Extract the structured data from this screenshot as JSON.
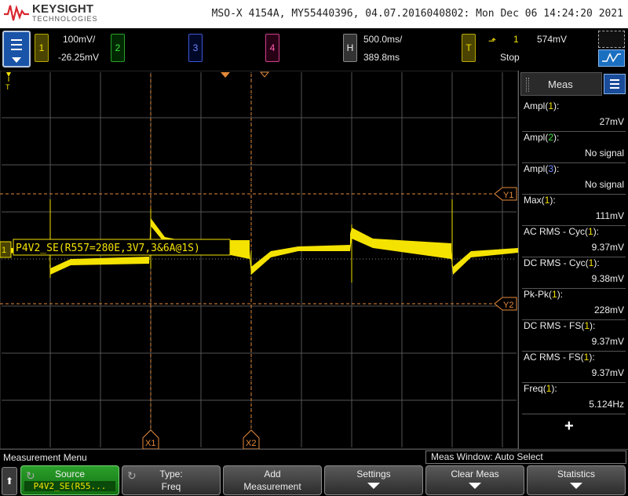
{
  "header": {
    "brand": "KEYSIGHT",
    "brand_sub": "TECHNOLOGIES",
    "instrument": "MSO-X 4154A, MY55440396, 04.07.2016040802: Mon Dec 06 14:24:20 2021"
  },
  "channels": {
    "ch1": {
      "num": "1",
      "scale": "100mV/",
      "offset": "-26.25mV",
      "color": "#f4e200"
    },
    "ch2": {
      "num": "2",
      "color": "#3ee63e"
    },
    "ch3": {
      "num": "3",
      "color": "#6b86ff"
    },
    "ch4": {
      "num": "4",
      "color": "#ff5fb0"
    },
    "horizontal": {
      "label": "H",
      "scale": "500.0ms/",
      "delay": "389.8ms"
    },
    "trigger": {
      "label": "T",
      "source": "1",
      "level": "574mV",
      "mode": "Stop"
    }
  },
  "graticule": {
    "waveform_label": "P4V2_SE(R557=280E,3V7,3&6A@1S)",
    "channel_marker": "1",
    "ground_marker": "T",
    "cursor_x1": "X1",
    "cursor_x2": "X2",
    "cursor_y1": "Y1",
    "cursor_y2": "Y2"
  },
  "meas_panel": {
    "tab_label": "Meas",
    "items": [
      {
        "name": "Ampl",
        "src": "1",
        "src_color": "c1",
        "value": "27mV"
      },
      {
        "name": "Ampl",
        "src": "2",
        "src_color": "c2",
        "value": "No signal"
      },
      {
        "name": "Ampl",
        "src": "3",
        "src_color": "c3",
        "value": "No signal"
      },
      {
        "name": "Max",
        "src": "1",
        "src_color": "c1",
        "value": "111mV"
      },
      {
        "name": "AC RMS - Cyc",
        "src": "1",
        "src_color": "c1",
        "value": "9.37mV"
      },
      {
        "name": "DC RMS - Cyc",
        "src": "1",
        "src_color": "c1",
        "value": "9.38mV"
      },
      {
        "name": "Pk-Pk",
        "src": "1",
        "src_color": "c1",
        "value": "228mV"
      },
      {
        "name": "DC RMS - FS",
        "src": "1",
        "src_color": "c1",
        "value": "9.37mV"
      },
      {
        "name": "AC RMS - FS",
        "src": "1",
        "src_color": "c1",
        "value": "9.37mV"
      },
      {
        "name": "Freq",
        "src": "1",
        "src_color": "c1",
        "value": "5.124Hz"
      }
    ],
    "add_symbol": "+"
  },
  "status": {
    "menu_title": "Measurement Menu",
    "meas_window": "Meas Window: Auto Select"
  },
  "softkeys": {
    "back": "⬆",
    "source": {
      "l1": "Source",
      "l2": "P4V2_SE(R55..."
    },
    "type": {
      "l1": "Type:",
      "l2": "Freq"
    },
    "add": {
      "l1": "Add",
      "l2": "Measurement"
    },
    "settings": {
      "l1": "Settings"
    },
    "clear": {
      "l1": "Clear Meas"
    },
    "statistics": {
      "l1": "Statistics"
    }
  }
}
